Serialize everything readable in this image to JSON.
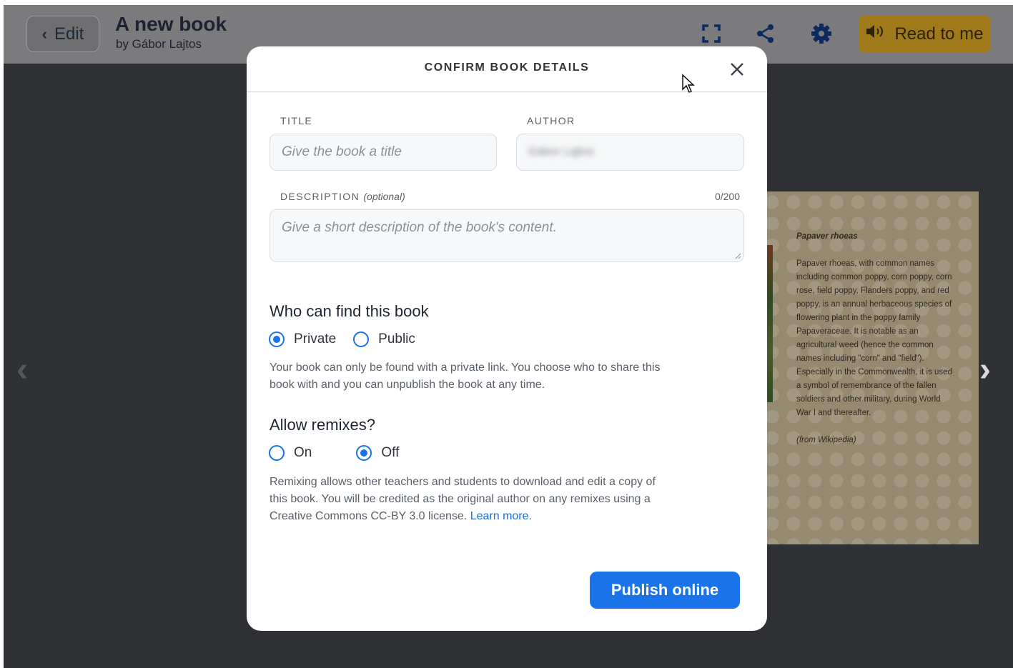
{
  "topbar": {
    "edit_label": "Edit",
    "book_title": "A new book",
    "book_author": "by Gábor Lajtos",
    "read_label": "Read to me"
  },
  "book_page": {
    "heading": "Papaver rhoeas",
    "body": "Papaver rhoeas, with common names including common poppy, corn poppy, corn rose, field poppy, Flanders poppy, and red poppy, is an annual herbaceous species of flowering plant in the poppy family Papaveraceae. It is notable as an agricultural weed (hence the common names including \"corn\" and \"field\"). Especially in the Commonwealth, it is used a symbol of remembrance of the fallen soldiers and other military, during World War I and thereafter.",
    "source": "(from Wikipedia)"
  },
  "modal": {
    "title": "CONFIRM BOOK DETAILS",
    "title_label": "TITLE",
    "title_placeholder": "Give the book a title",
    "author_label": "AUTHOR",
    "author_value": "Gábor Lajtos",
    "description_label": "DESCRIPTION",
    "description_optional": "(optional)",
    "description_counter": "0/200",
    "description_placeholder": "Give a short description of the book's content.",
    "visibility": {
      "heading": "Who can find this book",
      "options": [
        {
          "label": "Private",
          "selected": true
        },
        {
          "label": "Public",
          "selected": false
        }
      ],
      "help": "Your book can only be found with a private link. You choose who to share this book with and you can unpublish the book at any time."
    },
    "remix": {
      "heading": "Allow remixes?",
      "options": [
        {
          "label": "On",
          "selected": false
        },
        {
          "label": "Off",
          "selected": true
        }
      ],
      "help": "Remixing allows other teachers and students to download and edit a copy of this book. You will be credited as the original author on any remixes using a Creative Commons CC-BY 3.0 license.",
      "learn_more": "Learn more."
    },
    "publish_label": "Publish online"
  },
  "colors": {
    "accent": "#1a73e8",
    "read_button": "#a07a1a",
    "overlay": "#2f3033"
  },
  "icons": [
    "chevron-left-icon",
    "fullscreen-icon",
    "share-icon",
    "gear-icon",
    "speaker-icon",
    "close-icon",
    "cursor-icon",
    "chevron-right-icon"
  ]
}
